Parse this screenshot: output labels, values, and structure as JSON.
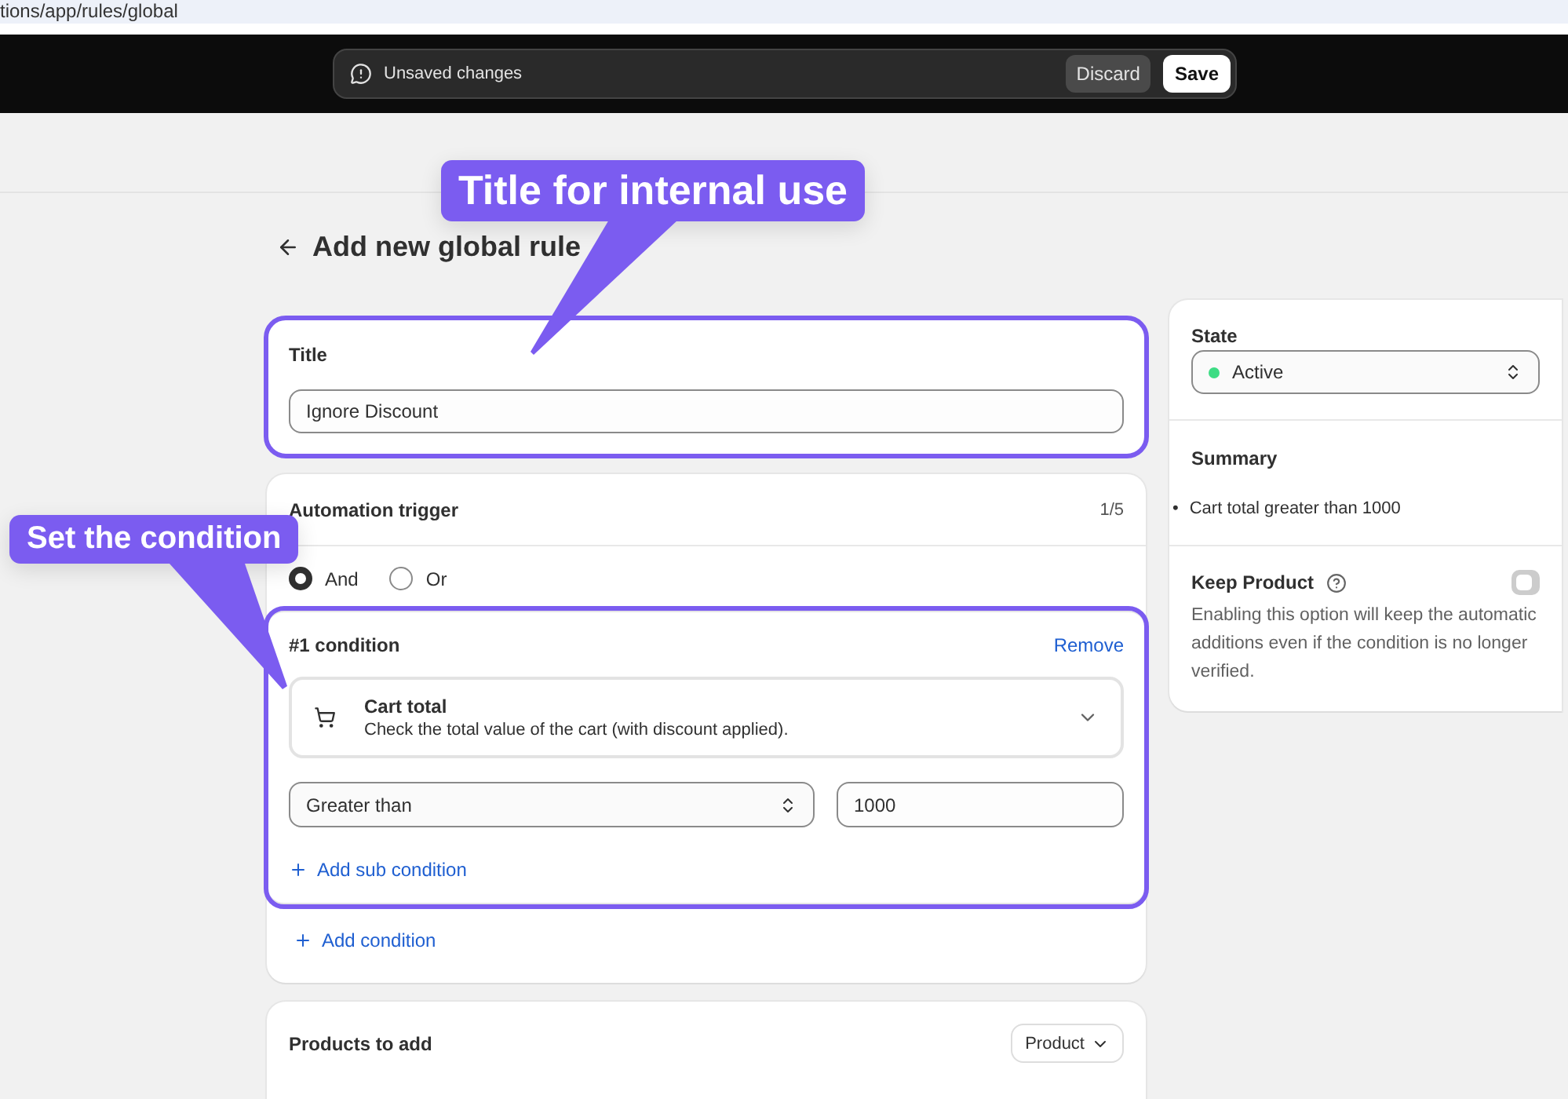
{
  "browser": {
    "url": "tions/app/rules/global"
  },
  "save_bar": {
    "message": "Unsaved changes",
    "buttons": [
      {
        "label": "Discard",
        "kind": "secondary"
      },
      {
        "label": "Save",
        "kind": "primary"
      }
    ]
  },
  "page": {
    "title": "Add new global rule"
  },
  "title_card": {
    "label": "Title",
    "value": "Ignore Discount",
    "highlighted": true
  },
  "trigger_card": {
    "title": "Automation trigger",
    "count": "1/5",
    "match_options": [
      {
        "label": "And",
        "selected": true
      },
      {
        "label": "Or",
        "selected": false
      }
    ],
    "conditions": [
      {
        "title": "#1 condition",
        "remove": "Remove",
        "highlighted": true,
        "type_title": "Cart total",
        "type_description": "Check the total value of the cart (with discount applied).",
        "operator": "Greater than",
        "value": "1000",
        "add_sub": "Add sub condition"
      }
    ],
    "add_condition": "Add condition"
  },
  "products_card": {
    "title": "Products to add",
    "dropdown": "Product"
  },
  "side_card": {
    "state_label": "State",
    "state_value": "Active",
    "summary_title": "Summary",
    "summary_items": [
      {
        "marker": "•",
        "text": "Cart total greater than 1000"
      }
    ],
    "keep_title": "Keep Product",
    "keep_on": false,
    "keep_description": "Enabling this option will keep the automatic additions even if the condition is no longer verified."
  },
  "annotations": [
    {
      "text": "Title for internal use"
    },
    {
      "text": "Set the condition"
    }
  ]
}
